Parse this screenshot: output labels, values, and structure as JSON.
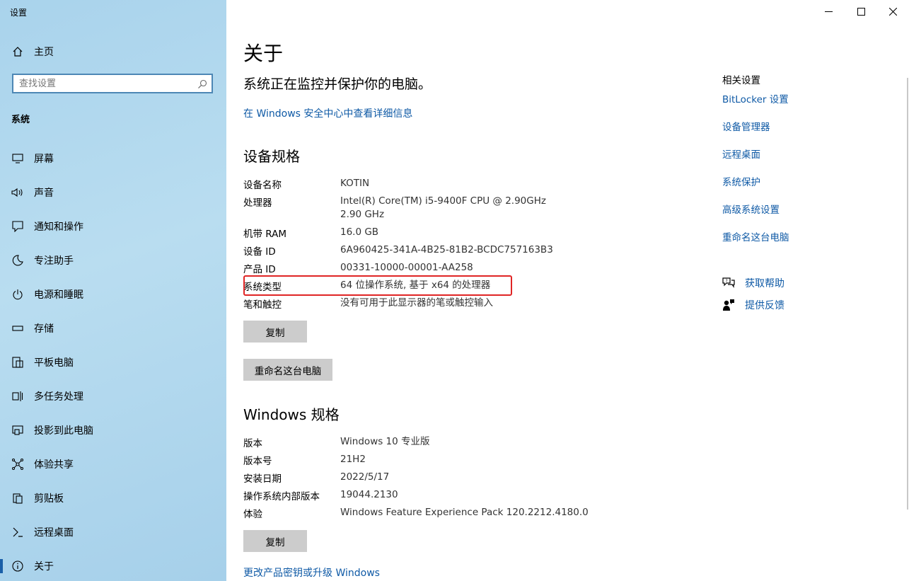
{
  "window": {
    "title": "设置"
  },
  "sidebar": {
    "home_label": "主页",
    "search_placeholder": "查找设置",
    "section": "系统",
    "items": [
      {
        "label": "屏幕",
        "icon": "monitor-icon"
      },
      {
        "label": "声音",
        "icon": "speaker-icon"
      },
      {
        "label": "通知和操作",
        "icon": "notification-icon"
      },
      {
        "label": "专注助手",
        "icon": "moon-icon"
      },
      {
        "label": "电源和睡眠",
        "icon": "power-icon"
      },
      {
        "label": "存储",
        "icon": "storage-icon"
      },
      {
        "label": "平板电脑",
        "icon": "tablet-icon"
      },
      {
        "label": "多任务处理",
        "icon": "multitask-icon"
      },
      {
        "label": "投影到此电脑",
        "icon": "project-icon"
      },
      {
        "label": "体验共享",
        "icon": "share-icon"
      },
      {
        "label": "剪贴板",
        "icon": "clipboard-icon"
      },
      {
        "label": "远程桌面",
        "icon": "remote-icon"
      },
      {
        "label": "关于",
        "icon": "info-icon",
        "active": true
      }
    ]
  },
  "main": {
    "title": "关于",
    "protect_text": "系统正在监控并保护你的电脑。",
    "security_link": "在 Windows 安全中心中查看详细信息",
    "device_specs": {
      "heading": "设备规格",
      "rows": [
        {
          "key": "设备名称",
          "value": "KOTIN"
        },
        {
          "key": "处理器",
          "value": "Intel(R) Core(TM) i5-9400F CPU @ 2.90GHz   2.90 GHz"
        },
        {
          "key": "机带 RAM",
          "value": "16.0 GB"
        },
        {
          "key": "设备 ID",
          "value": "6A960425-341A-4B25-81B2-BCDC757163B3"
        },
        {
          "key": "产品 ID",
          "value": "00331-10000-00001-AA258"
        },
        {
          "key": "系统类型",
          "value": "64 位操作系统, 基于 x64 的处理器"
        },
        {
          "key": "笔和触控",
          "value": "没有可用于此显示器的笔或触控输入"
        }
      ],
      "copy_label": "复制",
      "rename_label": "重命名这台电脑"
    },
    "windows_specs": {
      "heading": "Windows 规格",
      "rows": [
        {
          "key": "版本",
          "value": "Windows 10 专业版"
        },
        {
          "key": "版本号",
          "value": "21H2"
        },
        {
          "key": "安装日期",
          "value": "2022/5/17"
        },
        {
          "key": "操作系统内部版本",
          "value": "19044.2130"
        },
        {
          "key": "体验",
          "value": "Windows Feature Experience Pack 120.2212.4180.0"
        }
      ],
      "copy_label": "复制",
      "upgrade_link": "更改产品密钥或升级 Windows"
    }
  },
  "related": {
    "title": "相关设置",
    "links": [
      "BitLocker 设置",
      "设备管理器",
      "远程桌面",
      "系统保护",
      "高级系统设置",
      "重命名这台电脑"
    ],
    "help": "获取帮助",
    "feedback": "提供反馈"
  },
  "colors": {
    "accent": "#0f5aa6",
    "highlight": "#e02525",
    "sidebar": "#a9d3ec"
  }
}
